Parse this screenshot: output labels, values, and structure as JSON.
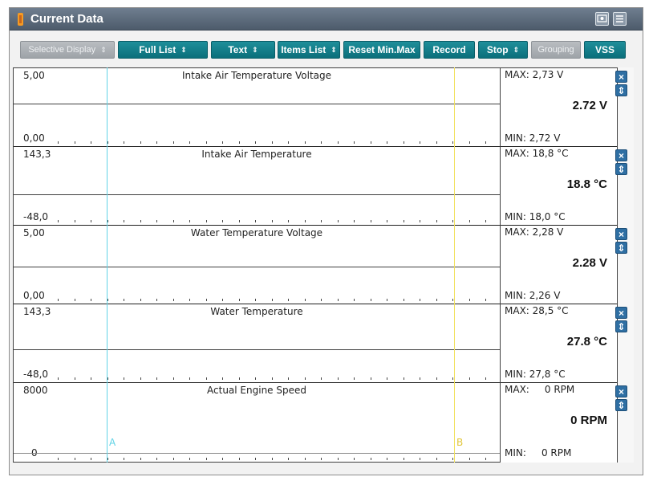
{
  "window": {
    "title": "Current Data"
  },
  "toolbar": {
    "buttons": [
      {
        "label": "Selective Display",
        "arrow": "⇕"
      },
      {
        "label": "Full List",
        "arrow": "⇕"
      },
      {
        "label": "Text",
        "arrow": "⇕"
      },
      {
        "label": "Items List",
        "arrow": "⇕"
      },
      {
        "label": "Reset Min.Max"
      },
      {
        "label": "Record"
      },
      {
        "label": "Stop",
        "arrow": "⇕"
      },
      {
        "label": "Grouping"
      },
      {
        "label": "VSS"
      }
    ]
  },
  "panels": [
    {
      "name": "Intake Air Temperature Voltage",
      "ymax": "5,00",
      "ymin": "0,00",
      "max": "MAX:  2,73 V",
      "min": "MIN:  2,72 V",
      "current": "2.72 V"
    },
    {
      "name": "Intake Air Temperature",
      "ymax": "143,3",
      "ymin": "-48,0",
      "max": "MAX:  18,8 °C",
      "min": "MIN:  18,0 °C",
      "current": "18.8 °C"
    },
    {
      "name": "Water Temperature Voltage",
      "ymax": "5,00",
      "ymin": "0,00",
      "max": "MAX:  2,28 V",
      "min": "MIN:  2,26 V",
      "current": "2.28 V"
    },
    {
      "name": "Water Temperature",
      "ymax": "143,3",
      "ymin": "-48,0",
      "max": "MAX:  28,5 °C",
      "min": "MIN:  27,8 °C",
      "current": "27.8 °C"
    },
    {
      "name": "Actual Engine Speed",
      "ymax": "8000",
      "ymin": "0",
      "max": "MAX:     0 RPM",
      "min": "MIN:     0 RPM",
      "current": "0 RPM"
    }
  ],
  "cursors": {
    "a": "A",
    "b": "B"
  },
  "icons": {
    "close": "×",
    "move": "⇕"
  },
  "colors": {
    "accent": "#0b6f7b",
    "cursor_a": "#61d3e6",
    "cursor_b": "#f1e05a"
  }
}
